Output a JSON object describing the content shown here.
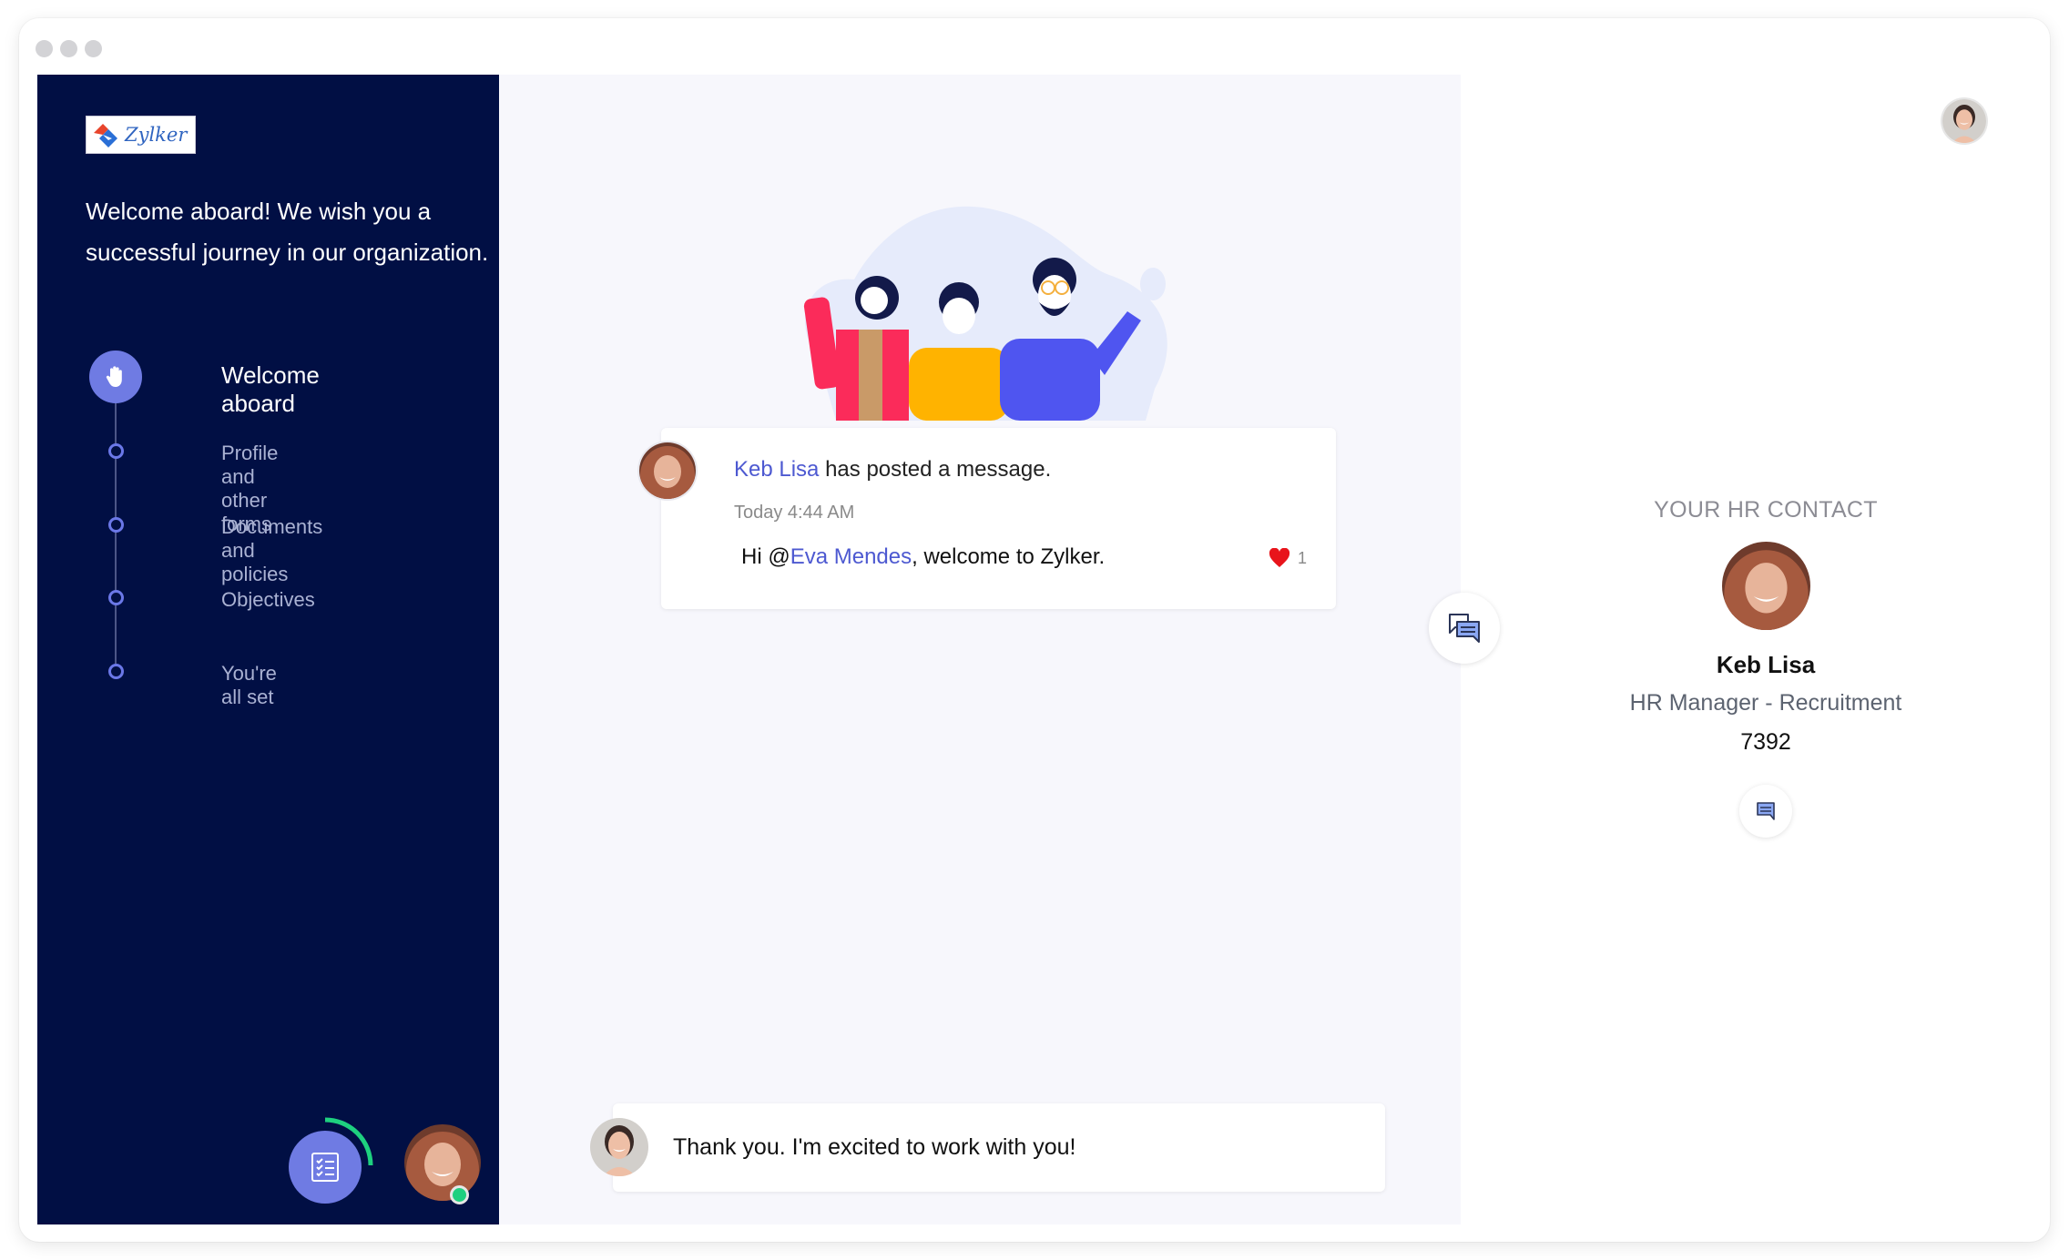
{
  "window": {
    "controls": [
      "close",
      "minimize",
      "maximize"
    ]
  },
  "brand": {
    "logo_text": "Zylker",
    "logo_icon": "zylker-logo-icon"
  },
  "sidebar": {
    "welcome_message": "Welcome aboard! We wish you a successful journey in our organization.",
    "steps": [
      {
        "label": "Welcome aboard",
        "icon": "hand-wave-icon",
        "active": true
      },
      {
        "label": "Profile and other forms",
        "active": false
      },
      {
        "label": "Documents and policies",
        "active": false
      },
      {
        "label": "Objectives",
        "active": false
      },
      {
        "label": "You're all set",
        "active": false
      }
    ],
    "tasks_button": {
      "icon": "checklist-icon",
      "progress_fraction": 0.25,
      "progress_color": "#1ed07f"
    },
    "user_status": "online"
  },
  "feed": {
    "post": {
      "author": "Keb Lisa",
      "action": " has posted a message.",
      "time": "Today 4:44 AM",
      "body_prefix": "Hi @",
      "mention": "Eva Mendes",
      "body_suffix": ", welcome to Zylker.",
      "likes": "1"
    },
    "reply": {
      "text": "Thank you. I'm excited to work with you!"
    }
  },
  "hr_contact": {
    "title": "YOUR HR CONTACT",
    "name": "Keb Lisa",
    "role": "HR Manager - Recruitment",
    "extension": "7392"
  },
  "colors": {
    "sidebar_bg": "#010f44",
    "accent": "#6f7be3",
    "link": "#4d59d1",
    "like": "#e8141b",
    "online": "#1ed07f"
  }
}
